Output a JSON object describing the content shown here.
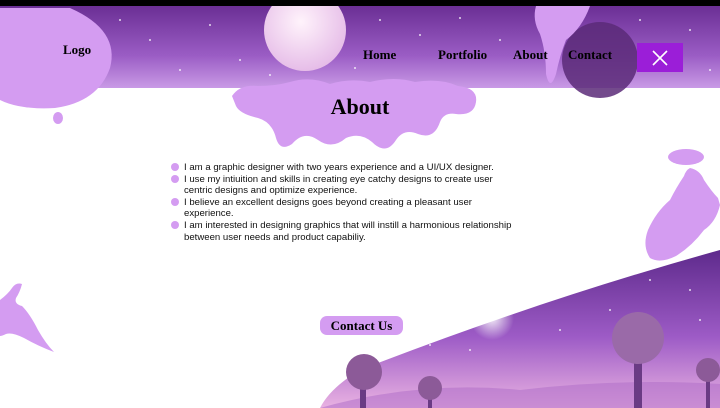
{
  "header": {
    "logo": "Logo",
    "nav": [
      {
        "label": "Home"
      },
      {
        "label": "Portfolio"
      },
      {
        "label": "About"
      },
      {
        "label": "Contact"
      }
    ],
    "close_icon": "close-icon"
  },
  "main": {
    "title": "About",
    "bullets": [
      "I am a graphic designer with two years experience and a UI/UX designer.",
      "I use my intiuition and skills in creating eye catchy designs to create user centric designs and optimize experience.",
      "I believe an excellent designs goes beyond creating a pleasant user experience.",
      " I am interested in designing graphics that will instill a harmonious relationship between user needs and product capabiliy."
    ],
    "contact_button": "Contact Us"
  },
  "colors": {
    "accent": "#9b1ed8",
    "lilac": "#d49cf1",
    "banner_dark": "#7c3fa6",
    "banner_light": "#c594e3"
  }
}
